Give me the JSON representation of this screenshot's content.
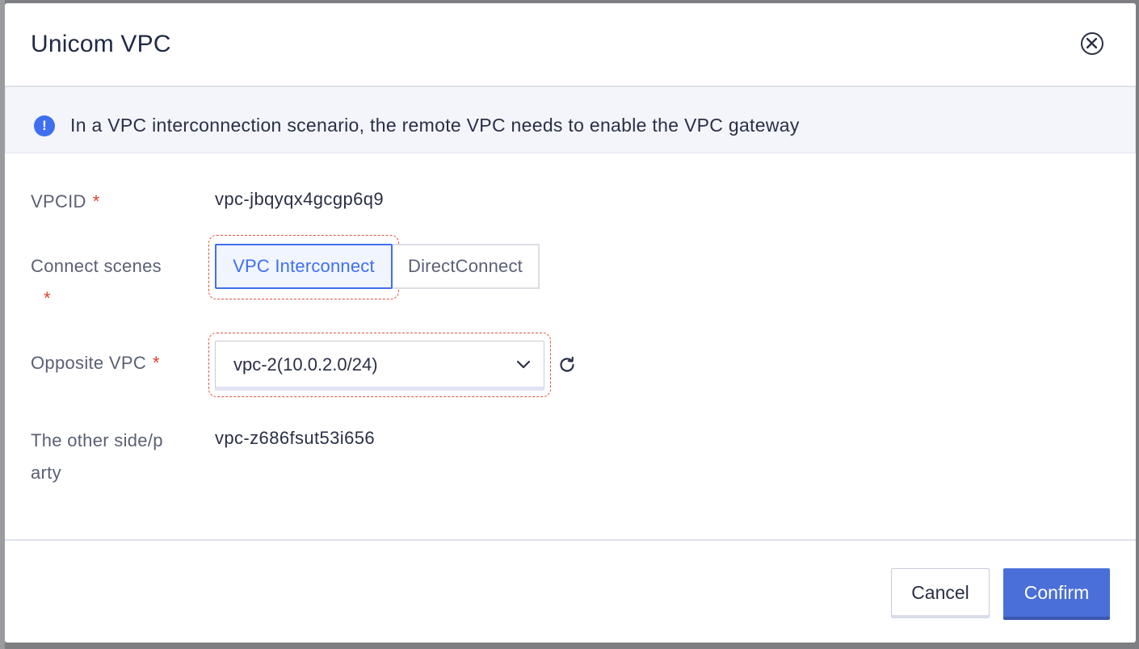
{
  "dialog": {
    "title": "Unicom VPC",
    "close_icon": "close-circle-icon"
  },
  "notice": {
    "icon": "info-icon",
    "icon_glyph": "!",
    "text": "In a VPC interconnection scenario, the remote VPC needs to enable the VPC gateway"
  },
  "form": {
    "required_mark": "*",
    "vpcid": {
      "label": "VPCID",
      "value": "vpc-jbqyqx4gcgp6q9"
    },
    "connect_scenes": {
      "label": "Connect scenes",
      "options": [
        "VPC Interconnect",
        "DirectConnect"
      ],
      "selected": "VPC Interconnect"
    },
    "opposite_vpc": {
      "label": "Opposite VPC",
      "selected": "vpc-2(10.0.2.0/24)",
      "dropdown_icon": "chevron-down-icon",
      "refresh_icon": "refresh-icon"
    },
    "other_side": {
      "label_line1": "The other side/p",
      "label_line2": "arty",
      "value": "vpc-z686fsut53i656"
    }
  },
  "footer": {
    "cancel_label": "Cancel",
    "confirm_label": "Confirm"
  },
  "colors": {
    "accent": "#3f6ff0",
    "confirm": "#4a6fd8",
    "required": "#e0402e",
    "highlight_dashed": "#e05545",
    "overlay": "#7d7f83"
  }
}
